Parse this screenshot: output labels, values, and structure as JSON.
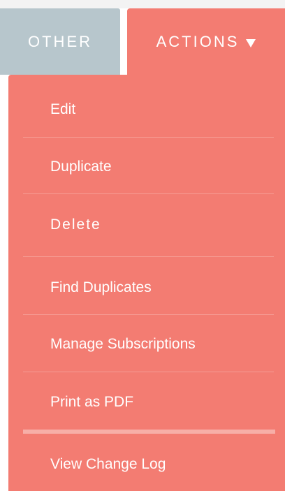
{
  "tabs": {
    "other": "OTHER",
    "actions": "ACTIONS"
  },
  "menu": {
    "items": [
      {
        "label": "Edit"
      },
      {
        "label": "Duplicate"
      },
      {
        "label": "Delete"
      },
      {
        "label": "Find Duplicates"
      },
      {
        "label": "Manage Subscriptions"
      },
      {
        "label": "Print as PDF"
      },
      {
        "label": "View Change Log"
      }
    ]
  },
  "colors": {
    "accent": "#f37c72",
    "other_tab": "#b7c6cc",
    "text": "#ffffff"
  },
  "icons": {
    "actions_dropdown": "triangle-down-icon"
  }
}
